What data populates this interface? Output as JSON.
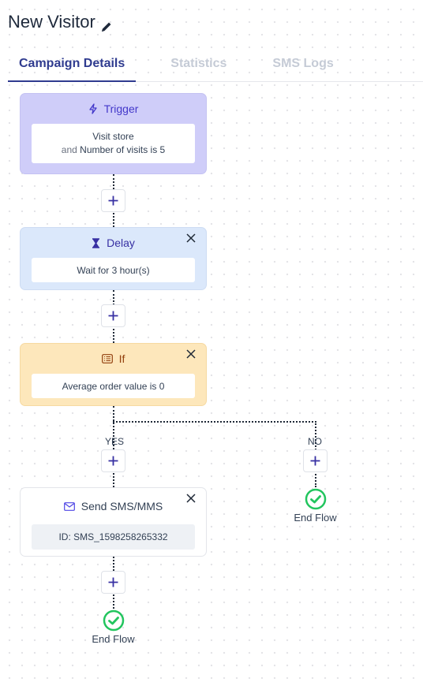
{
  "header": {
    "title": "New Visitor",
    "edit_icon": "pencil-icon"
  },
  "tabs": [
    {
      "label": "Campaign Details",
      "active": true
    },
    {
      "label": "Statistics",
      "active": false
    },
    {
      "label": "SMS Logs",
      "active": false
    }
  ],
  "flow": {
    "trigger": {
      "icon": "lightning-icon",
      "title": "Trigger",
      "line1": "Visit store",
      "line2_prefix": "and",
      "line2": "Number of visits is 5"
    },
    "delay": {
      "icon": "hourglass-icon",
      "title": "Delay",
      "body": "Wait for 3 hour(s)"
    },
    "if": {
      "icon": "list-icon",
      "title": "If",
      "body": "Average order value is 0"
    },
    "branches": {
      "yes_label": "YES",
      "no_label": "NO"
    },
    "send_sms": {
      "icon": "envelope-icon",
      "title": "Send SMS/MMS",
      "body": "ID: SMS_1598258265332"
    },
    "end_flow_yes": "End Flow",
    "end_flow_no": "End Flow"
  },
  "colors": {
    "accent": "#2f3b8f",
    "trigger_bg": "#cfcdf9",
    "delay_bg": "#dbe8fb",
    "if_bg": "#fde7bb",
    "end_flow_green": "#22c55e"
  }
}
